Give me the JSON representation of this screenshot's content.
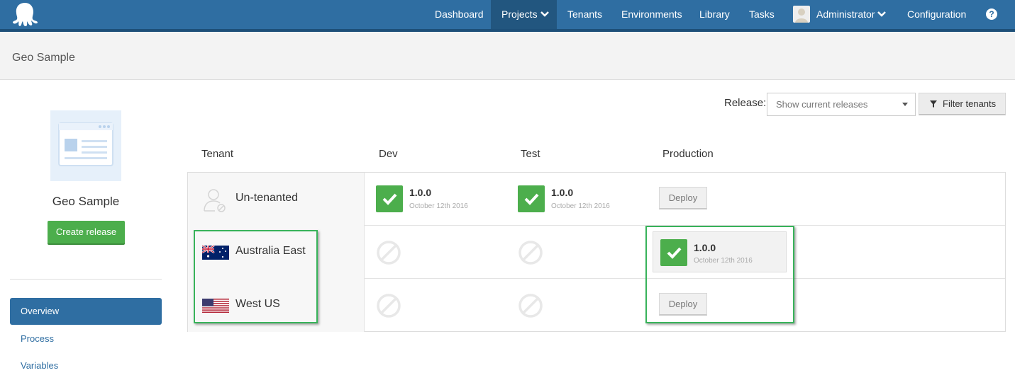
{
  "nav": {
    "items": [
      {
        "label": "Dashboard"
      },
      {
        "label": "Projects"
      },
      {
        "label": "Tenants"
      },
      {
        "label": "Environments"
      },
      {
        "label": "Library"
      },
      {
        "label": "Tasks"
      },
      {
        "label": "Administrator"
      },
      {
        "label": "Configuration"
      }
    ],
    "help_glyph": "?"
  },
  "header": {
    "title": "Geo Sample"
  },
  "sidebar": {
    "project_name": "Geo Sample",
    "create_release": "Create release",
    "items": [
      {
        "label": "Overview",
        "active": true
      },
      {
        "label": "Process"
      },
      {
        "label": "Variables"
      }
    ]
  },
  "filter": {
    "release_label": "Release:",
    "release_placeholder": "Show current releases",
    "filter_button": "Filter tenants"
  },
  "table": {
    "columns": [
      "Tenant",
      "Dev",
      "Test",
      "Production"
    ],
    "rows": [
      {
        "tenant": "Un-tenanted",
        "dev": {
          "version": "1.0.0",
          "date": "October 12th 2016"
        },
        "test": {
          "version": "1.0.0",
          "date": "October 12th 2016"
        },
        "production": {
          "deploy": "Deploy"
        }
      },
      {
        "tenant": "Australia East",
        "production": {
          "version": "1.0.0",
          "date": "October 12th 2016"
        }
      },
      {
        "tenant": "West US",
        "production": {
          "deploy": "Deploy"
        }
      }
    ]
  },
  "colors": {
    "brand": "#2f6ea2",
    "success": "#4cae4c",
    "highlight": "#38b35a"
  }
}
